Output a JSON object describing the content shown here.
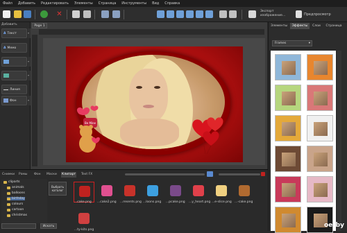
{
  "menu": [
    "Файл",
    "Добавить",
    "Редактировать",
    "Элементы",
    "Страница",
    "Инструменты",
    "Вид",
    "Справка"
  ],
  "toolbar": {
    "export_label": "Экспорт изображение...",
    "preview_label": "Предпросмотр"
  },
  "left_panel": {
    "heading": "Добавить",
    "buttons": [
      {
        "label": "Текст",
        "icon": "text-icon"
      },
      {
        "label": "Мемо",
        "icon": "memo-icon"
      },
      {
        "label": "",
        "icon": "image-icon"
      },
      {
        "label": "",
        "icon": "shape-icon"
      },
      {
        "label": "Линия",
        "icon": "line-icon"
      },
      {
        "label": "Фон",
        "icon": "background-icon"
      }
    ]
  },
  "canvas": {
    "page_tab": "Page 1"
  },
  "photo": {
    "sign_text": "Be Mine"
  },
  "right_panel": {
    "tabs": [
      "Элементы",
      "Эффекты",
      "Слои",
      "Страница"
    ],
    "active_tab": "Эффекты",
    "frames_select": "Frames",
    "frame_colors": [
      "#8fb7d9",
      "#e8862e",
      "#b6d67e",
      "#d97878",
      "#e4a93a",
      "#f0f0f0",
      "#6d4a35",
      "#c9a48a",
      "#c83a5a",
      "#e6b9c6",
      "#d08a30",
      "#1a1a1a"
    ]
  },
  "bottom_panel": {
    "tabs": [
      "Снимки",
      "Рамы",
      "Фон",
      "Маски",
      "Клипарт",
      "Text FX"
    ],
    "active_tab": "Клипарт",
    "tree": [
      "cliparts",
      "animals",
      "balloons",
      "birthday",
      "colours",
      "cartoon",
      "christmas"
    ],
    "select_button": "Выбрать каталог",
    "clear_button": "Искать",
    "clips": [
      {
        "file": "...cake.png",
        "color": "#c0221f"
      },
      {
        "file": "...cake2.png",
        "color": "#e05090"
      },
      {
        "file": "...resents.png",
        "color": "#c8322a"
      },
      {
        "file": "...loons.png",
        "color": "#3da0e0"
      },
      {
        "file": "...pcake.png",
        "color": "#7a4a8a"
      },
      {
        "file": "...y_heart.png",
        "color": "#e0404a"
      },
      {
        "file": "...e-slice.png",
        "color": "#f0d080"
      },
      {
        "file": "...-cake.png",
        "color": "#b06a30"
      },
      {
        "file": "...ty-kits.png",
        "color": "#d04040"
      }
    ]
  },
  "watermark": "oerby"
}
